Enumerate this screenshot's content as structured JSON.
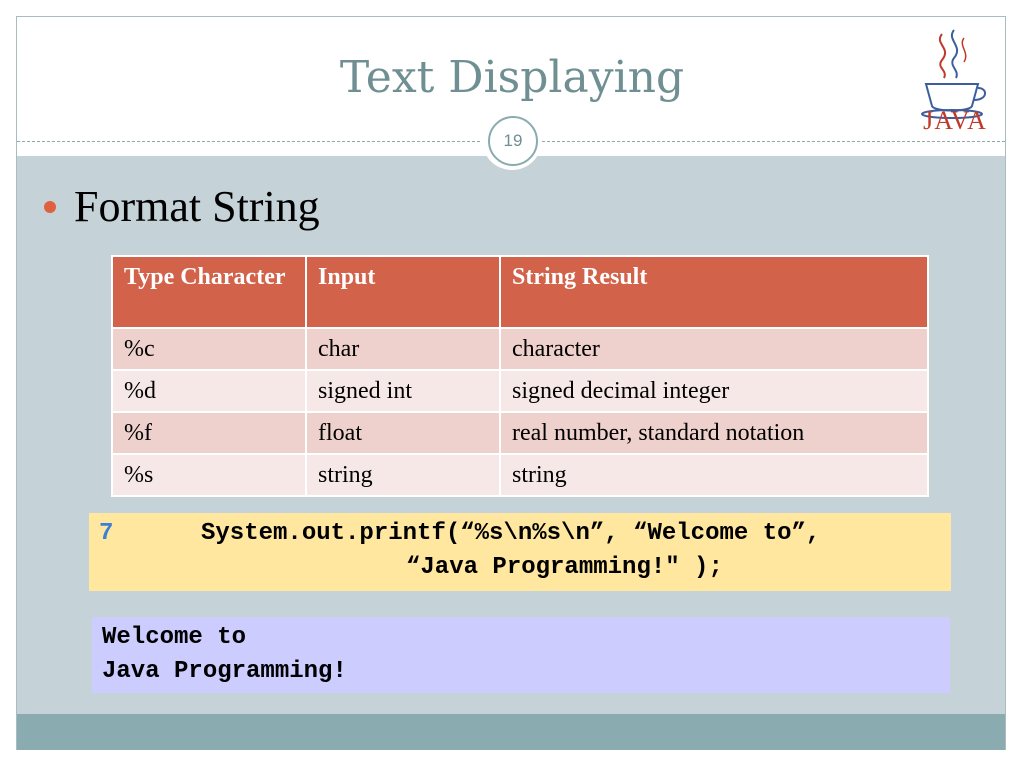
{
  "slide": {
    "title": "Text Displaying",
    "page_number": "19",
    "logo_text": "JAVA"
  },
  "bullet": {
    "text": "Format String"
  },
  "table": {
    "headers": [
      "Type Character",
      "Input",
      "String Result"
    ],
    "rows": [
      [
        "%c",
        "char",
        "character"
      ],
      [
        "%d",
        "signed int",
        "signed decimal integer"
      ],
      [
        "%f",
        "float",
        "real number, standard notation"
      ],
      [
        "%s",
        "string",
        "string"
      ]
    ]
  },
  "code": {
    "line_number": "7",
    "line1": "System.out.printf(“%s\\n%s\\n”, “Welcome to”,",
    "line2": "“Java Programming!\" );"
  },
  "output": {
    "line1": "Welcome to",
    "line2": "Java Programming!"
  },
  "colors": {
    "title": "#6f8f93",
    "table_header": "#d2624a",
    "code_background": "#ffe7a0",
    "output_background": "#ccccff",
    "bullet": "#e0613f"
  },
  "icons": {
    "logo": "java-coffee-cup-icon"
  }
}
